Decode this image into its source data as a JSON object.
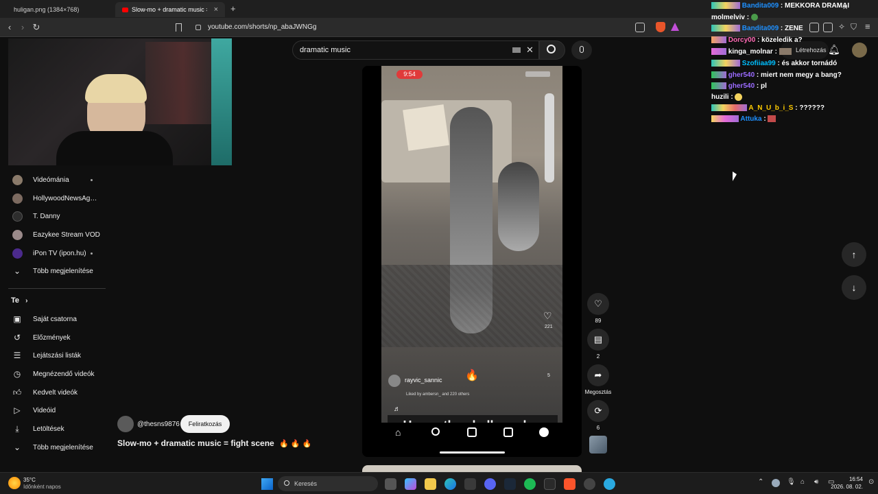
{
  "browser": {
    "tabs": [
      {
        "label": "huligan.png (1384×768)"
      },
      {
        "label": "Slow-mo + dramatic music = fight scene"
      }
    ],
    "url": "youtube.com/shorts/np_abaJWNGg"
  },
  "search": {
    "value": "dramatic music"
  },
  "sidebar": {
    "subscriptions": [
      {
        "label": "Videómánia",
        "color": "#8a7a6a"
      },
      {
        "label": "HollywoodNewsAg…",
        "color": "#7c6a60"
      },
      {
        "label": "T. Danny",
        "color": "#2d2d2d"
      },
      {
        "label": "Eazykee Stream VOD",
        "color": "#9a8a8a"
      },
      {
        "label": "iPon TV (ipon.hu)",
        "color": "#4b2a8c"
      }
    ],
    "more1": "Több megjelenítése",
    "you_header": "Te",
    "you_items": [
      {
        "label": "Saját csatorna",
        "icon": "channel-icon"
      },
      {
        "label": "Előzmények",
        "icon": "history-icon"
      },
      {
        "label": "Lejátszási listák",
        "icon": "playlist-icon"
      },
      {
        "label": "Megnézendő videók",
        "icon": "watch-later-icon"
      },
      {
        "label": "Kedvelt videók",
        "icon": "like-icon"
      },
      {
        "label": "Videóid",
        "icon": "your-videos-icon"
      },
      {
        "label": "Letöltések",
        "icon": "download-icon"
      }
    ],
    "more2": "Több megjelenítése"
  },
  "short": {
    "phone_time": "9:54",
    "caption": "Havoc the skull crusher",
    "poster": "rayvic_sannic",
    "liked_by": "Liked by ambersn_ and 220 others",
    "inner_likes": "221",
    "inner_shares": "5",
    "channel": "@thesns9876",
    "subscribe": "Feliratkozás",
    "title": "Slow-mo + dramatic music = fight scene"
  },
  "actions": {
    "likes": "89",
    "comments": "2",
    "share": "Megosztás",
    "remix": "6"
  },
  "chat": [
    {
      "user": "Bandita009",
      "color": "#1e90ff",
      "msg": "MEKKORA DRAMAI"
    },
    {
      "user": "molmelviv",
      "color": "#ffffff",
      "msg": ""
    },
    {
      "user": "Bandita009",
      "color": "#1e90ff",
      "msg": "ZENE"
    },
    {
      "user": "Dorcy00",
      "color": "#ff69b4",
      "msg": "közeledik a?"
    },
    {
      "user": "kinga_molnar",
      "color": "#ffffff",
      "msg": ""
    },
    {
      "user": "Szofiiaa99",
      "color": "#00bfff",
      "msg": "és akkor tornádó"
    },
    {
      "user": "gher540",
      "color": "#9b6bff",
      "msg": "miert nem megy a bang?"
    },
    {
      "user": "gher540",
      "color": "#9b6bff",
      "msg": "pl"
    },
    {
      "user": "huzili",
      "color": "#ffffff",
      "msg": ""
    },
    {
      "user": "A_N_U_b_i_S",
      "color": "#ffcc00",
      "msg": "??????"
    },
    {
      "user": "Attuka",
      "color": "#1e90ff",
      "msg": ""
    }
  ],
  "header_right": {
    "upload": "Létrehozás"
  },
  "taskbar": {
    "weather_temp": "35°C",
    "weather_desc": "Időnként napos",
    "search": "Keresés",
    "time": "16:54",
    "date": "2026. 08. 02."
  }
}
